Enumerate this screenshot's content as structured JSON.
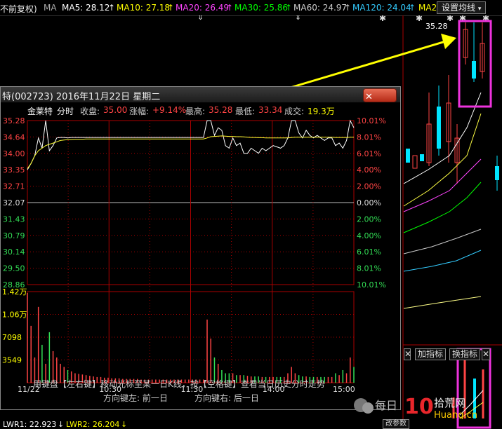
{
  "topbar": {
    "stock_label": "不前复权)",
    "ma_selector": "MA",
    "ma5": "MA5: 28.12",
    "ma10": "MA10: 27.18",
    "ma20": "MA20: 26.49",
    "ma30": "MA30: 25.86",
    "ma60": "MA60: 24.97",
    "ma120": "MA120: 24.04",
    "ma2": "MA2",
    "settings": "设置均线",
    "arrow": "↑",
    "colors": {
      "ma5": "#ffffff",
      "ma10": "#ffff00",
      "ma20": "#ff44ff",
      "ma30": "#00ff00",
      "ma60": "#cccccc",
      "ma120": "#33ccff"
    }
  },
  "kline": {
    "high_label": "35.28",
    "indicator_btn": "加指标",
    "indicator_btn2": "换指标",
    "indicator_btn3": "改参数"
  },
  "popup": {
    "title": "特(002723) 2016年11月22日 星期二",
    "close_label": "✕",
    "info": {
      "name": "金莱特",
      "kind": "分时",
      "close_label": "收盘:",
      "close_value": "35.00",
      "change_label": "涨幅:",
      "change_value": "+9.14%",
      "high_label": "最高:",
      "high_value": "35.28",
      "low_label": "最低:",
      "low_value": "33.34",
      "vol_label": "成交:",
      "vol_value": "19.3万"
    },
    "hint1": "用键盘【左右键】移动光标至某一日K线，按【空格键】查看当日历史分时走势",
    "hint2_left": "方向键左: 前一日",
    "hint2_right": "方向键右: 后一日"
  },
  "chart_data": {
    "type": "line",
    "title": "金莱特 分时",
    "price_ticks": [
      "35.28",
      "34.64",
      "34.00",
      "33.35",
      "32.71",
      "32.07",
      "31.43",
      "30.79",
      "30.14",
      "29.50",
      "28.86"
    ],
    "pct_ticks": [
      "10.01%",
      "8.01%",
      "6.01%",
      "4.00%",
      "2.00%",
      "0.00%",
      "2.00%",
      "4.00%",
      "6.01%",
      "8.01%",
      "10.01%"
    ],
    "volume_ticks": [
      "1.42万",
      "1.06万",
      "7098",
      "3549"
    ],
    "time_ticks": [
      "11/22",
      "10:30",
      "11:30",
      "14:00",
      "15:00"
    ],
    "ylim": [
      28.86,
      35.28
    ],
    "prev_close": 32.07,
    "series": [
      {
        "values": [
          33.35,
          33.6,
          33.9,
          34.6,
          34.2,
          35.28,
          34.1,
          34.3,
          34.6,
          34.62,
          34.62,
          34.6,
          34.62,
          34.62,
          34.62,
          34.62,
          34.62,
          34.62,
          34.62,
          34.62,
          34.62,
          34.62,
          34.62,
          34.62,
          34.62,
          34.62,
          34.62,
          34.62,
          34.62,
          34.62,
          34.62,
          34.62,
          34.62,
          34.62,
          34.62,
          34.62,
          34.62,
          34.62,
          34.62,
          34.62,
          34.62,
          34.62,
          34.62,
          34.62,
          34.62,
          34.62,
          34.62,
          34.62,
          34.62,
          35.28,
          35.28,
          34.7,
          35.0,
          34.9,
          34.3,
          34.2,
          34.6,
          34.3,
          34.4,
          34.0,
          34.0,
          34.2,
          34.1,
          34.0,
          34.2,
          34.1,
          34.2,
          34.3,
          34.25,
          34.2,
          34.3,
          34.6,
          35.28,
          35.28,
          34.8,
          34.6,
          34.9,
          34.7,
          34.6,
          34.7,
          34.6,
          34.5,
          34.6,
          34.6,
          34.3,
          34.4,
          34.2,
          34.5,
          35.28,
          35.0
        ],
        "color": "#ffffff"
      },
      {
        "values": [
          33.4,
          33.6,
          33.9,
          34.1,
          34.2,
          34.3,
          34.35,
          34.4,
          34.45,
          34.5,
          34.52,
          34.53,
          34.54,
          34.55,
          34.55,
          34.55,
          34.56,
          34.56,
          34.56,
          34.56,
          34.56,
          34.56,
          34.56,
          34.56,
          34.56,
          34.56,
          34.56,
          34.56,
          34.56,
          34.56,
          34.56,
          34.56,
          34.56,
          34.56,
          34.56,
          34.56,
          34.56,
          34.56,
          34.56,
          34.56,
          34.56,
          34.56,
          34.56,
          34.56,
          34.56,
          34.56,
          34.56,
          34.56,
          34.56,
          34.6,
          34.65,
          34.66,
          34.67,
          34.68,
          34.67,
          34.66,
          34.66,
          34.65,
          34.65,
          34.64,
          34.63,
          34.62,
          34.62,
          34.61,
          34.61,
          34.6,
          34.6,
          34.6,
          34.6,
          34.6,
          34.6,
          34.6,
          34.62,
          34.63,
          34.63,
          34.63,
          34.63,
          34.63,
          34.63,
          34.63,
          34.63,
          34.63,
          34.63,
          34.63,
          34.62,
          34.62,
          34.62,
          34.62,
          34.63,
          34.63
        ],
        "color": "#ffff33"
      }
    ],
    "volume": [
      14200,
      9000,
      4000,
      12000,
      6000,
      3000,
      8000,
      5000,
      4000,
      3000,
      2500,
      2000,
      1800,
      1500,
      1400,
      1300,
      1200,
      1100,
      1000,
      900,
      900,
      800,
      800,
      700,
      700,
      700,
      600,
      600,
      600,
      600,
      600,
      500,
      500,
      500,
      500,
      500,
      500,
      500,
      500,
      500,
      500,
      500,
      500,
      500,
      500,
      500,
      500,
      500,
      500,
      10000,
      7000,
      4000,
      3000,
      2000,
      1500,
      1500,
      1500,
      1200,
      1200,
      1200,
      1100,
      1000,
      1000,
      1000,
      900,
      900,
      900,
      900,
      900,
      900,
      900,
      1500,
      2500,
      1500,
      1200,
      1000,
      1000,
      900,
      900,
      900,
      900,
      900,
      900,
      900,
      1500,
      1200,
      2000,
      1500,
      4000,
      2500
    ]
  }
}
